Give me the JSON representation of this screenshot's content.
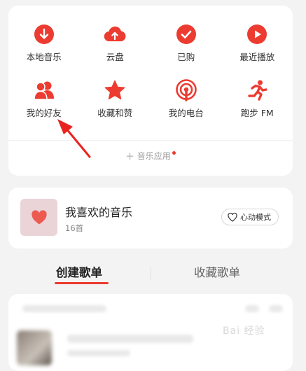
{
  "grid": {
    "items": [
      {
        "label": "本地音乐",
        "icon": "download-icon"
      },
      {
        "label": "云盘",
        "icon": "cloud-upload-icon"
      },
      {
        "label": "已购",
        "icon": "check-icon"
      },
      {
        "label": "最近播放",
        "icon": "play-icon"
      },
      {
        "label": "我的好友",
        "icon": "friends-icon"
      },
      {
        "label": "收藏和赞",
        "icon": "star-icon"
      },
      {
        "label": "我的电台",
        "icon": "radio-icon"
      },
      {
        "label": "跑步 FM",
        "icon": "running-icon"
      }
    ],
    "add_apps_label": "音乐应用"
  },
  "favorites": {
    "title": "我喜欢的音乐",
    "count": "16首",
    "heart_mode_label": "心动模式"
  },
  "tabs": {
    "create": "创建歌单",
    "collect": "收藏歌单"
  },
  "watermark": "Bai 经验",
  "colors": {
    "accent": "#ec3b30",
    "card_bg": "#ffffff",
    "page_bg": "#f3f3f4",
    "annotation_arrow": "#e8231f"
  }
}
